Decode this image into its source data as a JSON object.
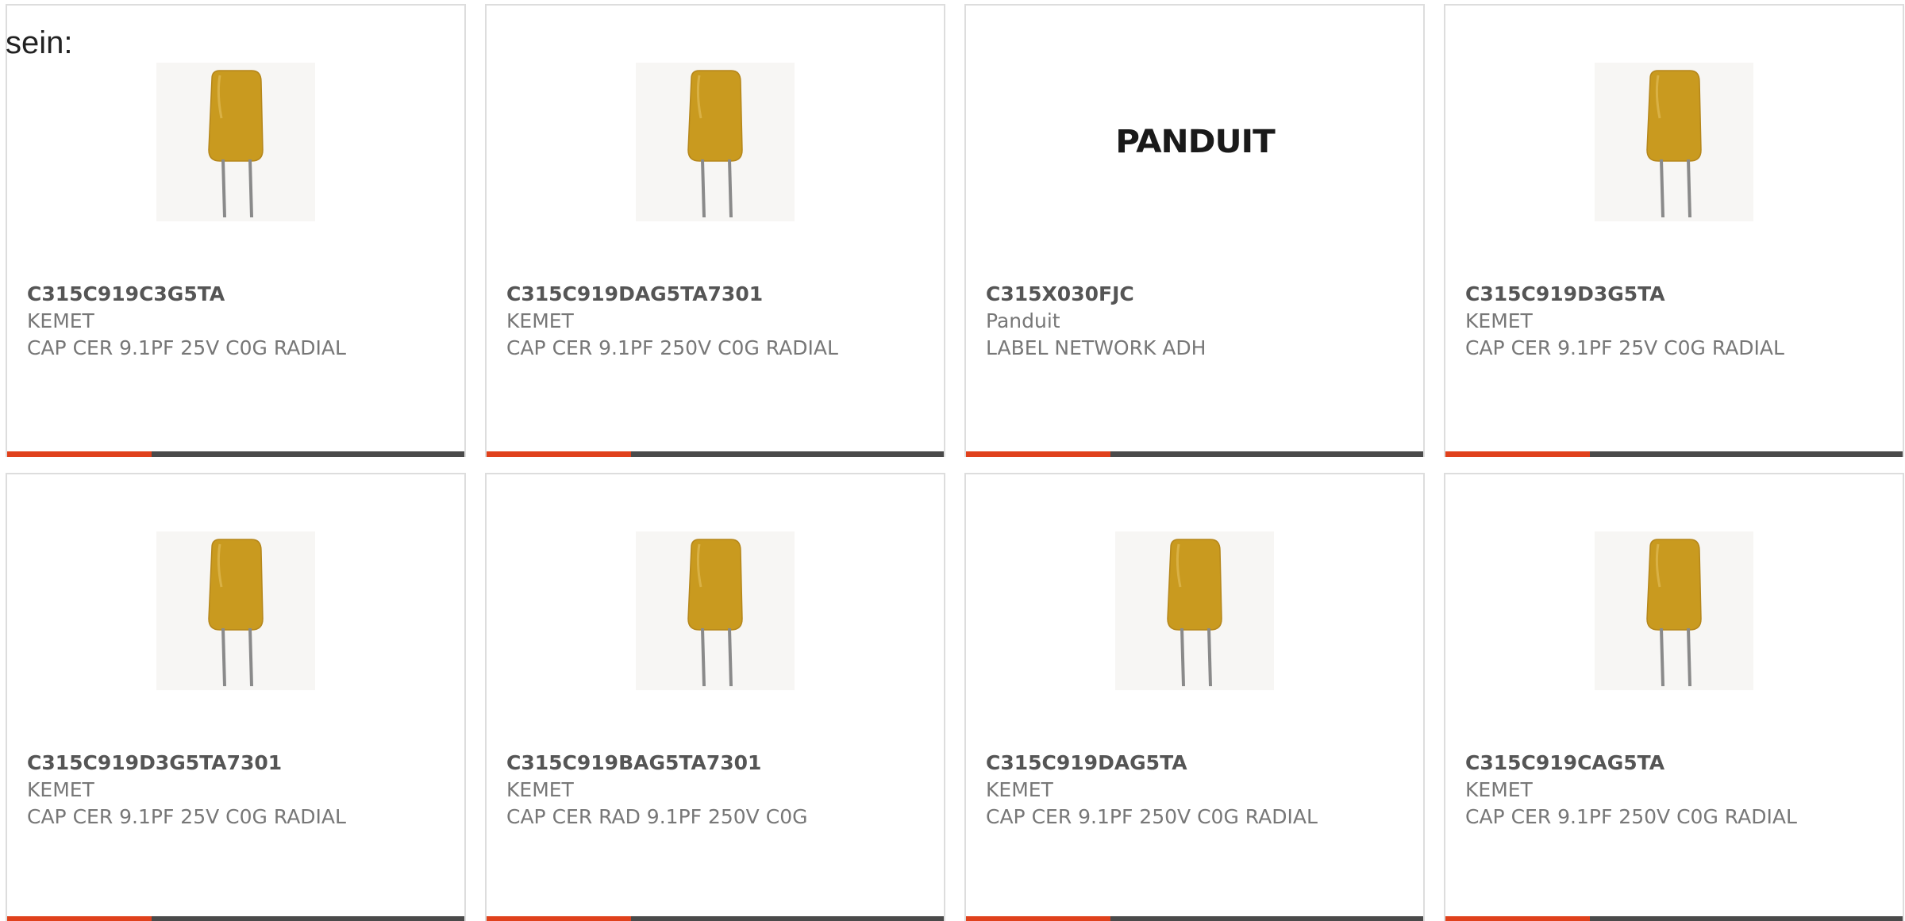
{
  "intro_text": "sein:",
  "colors": {
    "accent": "#e0411c",
    "bar": "#4a4a4a",
    "border": "#dddddd",
    "capacitor": "#c99a1f"
  },
  "products": [
    {
      "part": "C315C919C3G5TA",
      "manufacturer": "KEMET",
      "description": "CAP CER 9.1PF 25V C0G RADIAL",
      "image": "capacitor-icon"
    },
    {
      "part": "C315C919DAG5TA7301",
      "manufacturer": "KEMET",
      "description": "CAP CER 9.1PF 250V C0G RADIAL",
      "image": "capacitor-icon"
    },
    {
      "part": "C315X030FJC",
      "manufacturer": "Panduit",
      "description": "LABEL NETWORK ADH",
      "image": "panduit-logo",
      "logo_text": "PANDUIT"
    },
    {
      "part": "C315C919D3G5TA",
      "manufacturer": "KEMET",
      "description": "CAP CER 9.1PF 25V C0G RADIAL",
      "image": "capacitor-icon"
    },
    {
      "part": "C315C919D3G5TA7301",
      "manufacturer": "KEMET",
      "description": "CAP CER 9.1PF 25V C0G RADIAL",
      "image": "capacitor-icon"
    },
    {
      "part": "C315C919BAG5TA7301",
      "manufacturer": "KEMET",
      "description": "CAP CER RAD 9.1PF 250V C0G",
      "image": "capacitor-icon"
    },
    {
      "part": "C315C919DAG5TA",
      "manufacturer": "KEMET",
      "description": "CAP CER 9.1PF 250V C0G RADIAL",
      "image": "capacitor-icon"
    },
    {
      "part": "C315C919CAG5TA",
      "manufacturer": "KEMET",
      "description": "CAP CER 9.1PF 250V C0G RADIAL",
      "image": "capacitor-icon"
    }
  ]
}
